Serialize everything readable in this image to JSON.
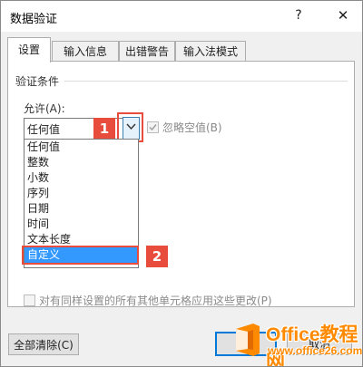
{
  "window": {
    "title": "数据验证",
    "help": "?",
    "close": "✕"
  },
  "tabs": [
    {
      "label": "设置",
      "active": true
    },
    {
      "label": "输入信息",
      "active": false
    },
    {
      "label": "出错警告",
      "active": false
    },
    {
      "label": "输入法模式",
      "active": false
    }
  ],
  "settings": {
    "section_label": "验证条件",
    "allow_label": "允许(A):",
    "allow_value": "任何值",
    "ignore_blank_label": "忽略空值(B)",
    "ignore_blank_checked": true,
    "apply_all_label": "对有同样设置的所有其他单元格应用这些更改(P)",
    "apply_all_checked": false
  },
  "allow_options": [
    "任何值",
    "整数",
    "小数",
    "序列",
    "日期",
    "时间",
    "文本长度",
    "自定义"
  ],
  "selected_option": "自定义",
  "callouts": [
    "1",
    "2"
  ],
  "buttons": {
    "clear_all": "全部清除(C)",
    "ok": "定",
    "cancel": "取消"
  },
  "watermark": {
    "title": "Office教程网",
    "url": "www.office26.com"
  },
  "colors": {
    "callout": "#e84c3d",
    "selection": "#3399ff",
    "focus_border": "#0078d7",
    "watermark": "#ff8a00"
  }
}
